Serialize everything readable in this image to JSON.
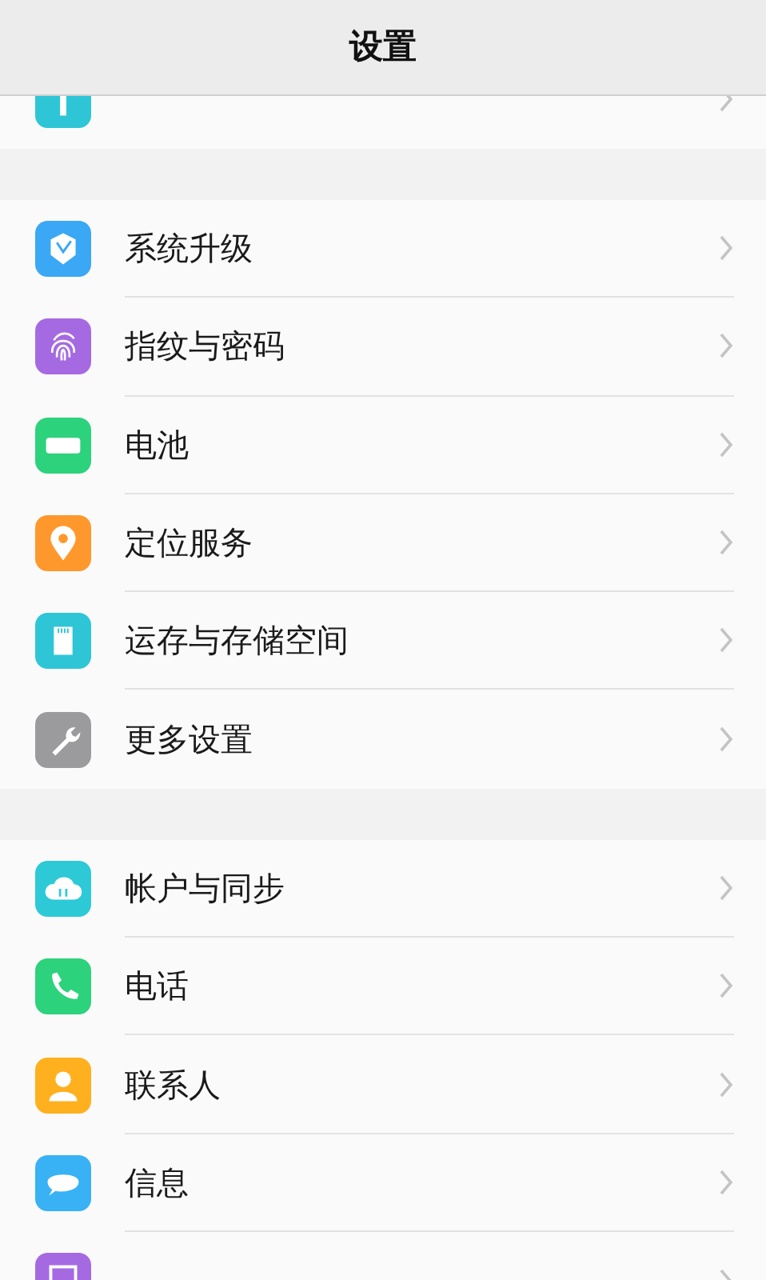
{
  "title": "设置",
  "sections": [
    {
      "items": [
        {
          "kind": "font",
          "color": "#2ec6d6"
        }
      ]
    },
    {
      "items": [
        {
          "label": "系统升级",
          "kind": "upgrade",
          "color": "#3aa8f4"
        },
        {
          "label": "指纹与密码",
          "kind": "fingerprint",
          "color": "#a56ae2"
        },
        {
          "label": "电池",
          "kind": "battery",
          "color": "#2dd27c"
        },
        {
          "label": "定位服务",
          "kind": "location",
          "color": "#ff982c"
        },
        {
          "label": "运存与存储空间",
          "kind": "storage",
          "color": "#2ec6d6"
        },
        {
          "label": "更多设置",
          "kind": "wrench",
          "color": "#9b9b9e"
        }
      ]
    },
    {
      "items": [
        {
          "label": "帐户与同步",
          "kind": "cloud",
          "color": "#2ec9d6"
        },
        {
          "label": "电话",
          "kind": "phone",
          "color": "#2dd27c"
        },
        {
          "label": "联系人",
          "kind": "contact",
          "color": "#ffb01e"
        },
        {
          "label": "信息",
          "kind": "message",
          "color": "#38b2f5"
        },
        {
          "kind": "album",
          "color": "#a56ae2"
        }
      ]
    }
  ]
}
